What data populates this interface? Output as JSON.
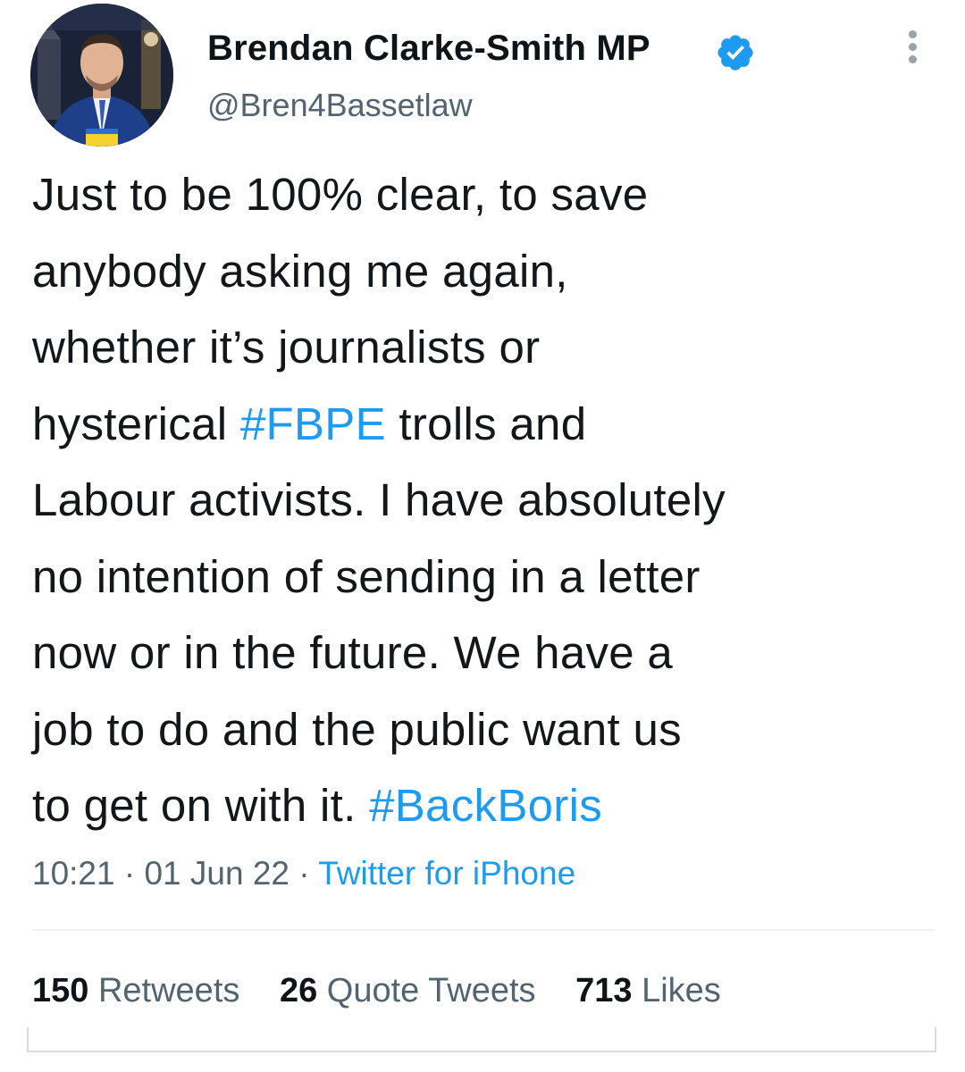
{
  "author": {
    "display_name": "Brendan Clarke-Smith MP",
    "handle": "@Bren4Bassetlaw",
    "verified": true
  },
  "tweet": {
    "lines": [
      [
        {
          "text": "Just to be 100% clear, to save",
          "type": "text"
        }
      ],
      [
        {
          "text": "anybody asking me again,",
          "type": "text"
        }
      ],
      [
        {
          "text": "whether it’s journalists or",
          "type": "text"
        }
      ],
      [
        {
          "text": "hysterical ",
          "type": "text"
        },
        {
          "text": "#FBPE",
          "type": "hashtag"
        },
        {
          "text": " trolls and",
          "type": "text"
        }
      ],
      [
        {
          "text": "Labour activists. I have absolutely",
          "type": "text"
        }
      ],
      [
        {
          "text": "no intention of sending in a letter",
          "type": "text"
        }
      ],
      [
        {
          "text": "now or in the future. We have a",
          "type": "text"
        }
      ],
      [
        {
          "text": "job to do and the public want us",
          "type": "text"
        }
      ],
      [
        {
          "text": "to get on with it. ",
          "type": "text"
        },
        {
          "text": "#BackBoris",
          "type": "hashtag"
        }
      ]
    ]
  },
  "meta": {
    "time": "10:21",
    "separator": " · ",
    "date": "01 Jun 22",
    "source": "Twitter for iPhone"
  },
  "stats": {
    "retweets": {
      "count": "150",
      "label": "Retweets"
    },
    "quotes": {
      "count": "26",
      "label": "Quote Tweets"
    },
    "likes": {
      "count": "713",
      "label": "Likes"
    }
  },
  "colors": {
    "accent": "#1d9bf0",
    "text": "#0f1419",
    "secondary": "#536471"
  },
  "icons": {
    "verified": "verified-badge-icon",
    "more": "more-options-icon"
  }
}
